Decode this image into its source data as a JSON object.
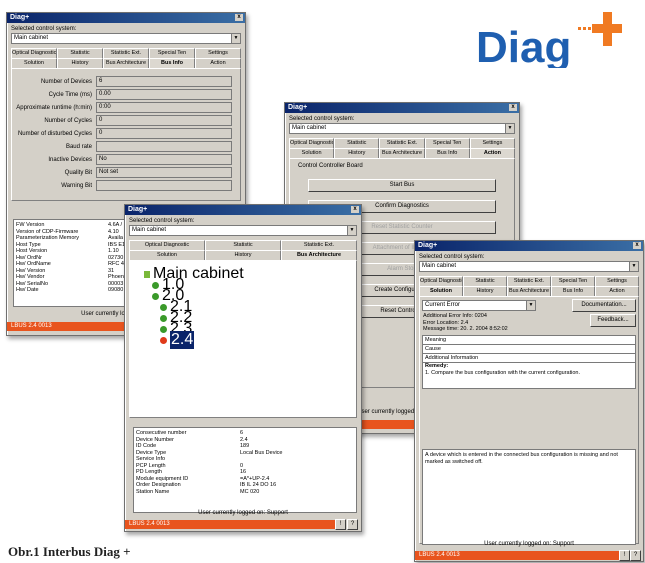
{
  "logo": {
    "text": "Diag",
    "plus": "+"
  },
  "caption": "Obr.1 Interbus Diag +",
  "common": {
    "app_title": "Diag+",
    "close": "x",
    "selected_label": "Selected control system:",
    "selected_value": "Main cabinet",
    "status_text": "User currently logged on: Support",
    "status_bar": "LBUS 2.4 0013"
  },
  "win1": {
    "tabs_row1": [
      "Optical Diagnostic",
      "Statistic",
      "Statistic Ext.",
      "Special Ten",
      "Settings"
    ],
    "tabs_row2": [
      "Solution",
      "History",
      "Bus Architecture",
      "Bus Info",
      "Action"
    ],
    "fields": [
      {
        "label": "Number of Devices",
        "value": "6"
      },
      {
        "label": "Cycle Time (ms)",
        "value": "0.00"
      },
      {
        "label": "Approximate runtime (h:min)",
        "value": "0:00"
      },
      {
        "label": "Number of Cycles",
        "value": "0"
      },
      {
        "label": "Number of disturbed Cycles",
        "value": "0"
      },
      {
        "label": "Baud rate",
        "value": ""
      },
      {
        "label": "Inactive Devices",
        "value": "No"
      },
      {
        "label": "Quality Bit",
        "value": "Not set"
      },
      {
        "label": "Warning Bit",
        "value": ""
      }
    ],
    "info": [
      {
        "k": "FW Version",
        "v": "4.6A /"
      },
      {
        "k": "Version of CDP-Firmware",
        "v": "4.10"
      },
      {
        "k": "Parameterization Memory",
        "v": "Availa"
      },
      {
        "k": "Host Type",
        "v": "IBS E1"
      },
      {
        "k": "Host Version",
        "v": "1.10"
      },
      {
        "k": "Hw/ OrdNr",
        "v": "02730"
      },
      {
        "k": "Hw/ OrdName",
        "v": "RFC 4"
      },
      {
        "k": "Hw/ Version",
        "v": "31"
      },
      {
        "k": "Hw/ Vendor",
        "v": "Phoen"
      },
      {
        "k": "Hw/ SerialNo",
        "v": "00003"
      },
      {
        "k": "Hw/ Date",
        "v": "09080"
      }
    ]
  },
  "win2": {
    "tabs_row1": [
      "Optical Diagnostic",
      "Statistic",
      "Statistic Ext.",
      "Special Ten",
      "Settings"
    ],
    "tabs_row2": [
      "Solution",
      "History",
      "Bus Architecture",
      "Bus Info",
      "Action"
    ],
    "group_title": "Control Controller Board",
    "buttons": [
      "Start Bus",
      "Confirm Diagnostics",
      "Reset Statistic Counter",
      "Attachment of IP-Host",
      "Alarm Stop",
      "Create Configuration",
      "Reset Controller"
    ]
  },
  "win3": {
    "tabs_row1": [
      "Optical Diagnostic",
      "Statistic",
      "Statistic Ext."
    ],
    "tabs_row2": [
      "Solution",
      "History",
      "Bus Architecture"
    ],
    "tree": [
      {
        "label": "Main cabinet"
      },
      {
        "label": "1.0"
      },
      {
        "label": "2.0"
      },
      {
        "label": "2.1"
      },
      {
        "label": "2.2"
      },
      {
        "label": "2.3"
      },
      {
        "label": "2.4"
      }
    ],
    "props": [
      {
        "k": "Consecutive number",
        "v": "6"
      },
      {
        "k": "Device Number",
        "v": "2.4"
      },
      {
        "k": "ID Code",
        "v": "189"
      },
      {
        "k": "Device Type",
        "v": "Local Bus Device"
      },
      {
        "k": "Service Info",
        "v": ""
      },
      {
        "k": "PCP Length",
        "v": "0"
      },
      {
        "k": "PD Length",
        "v": "16"
      },
      {
        "k": "Module equipment ID",
        "v": "=A*+UP-2.4"
      },
      {
        "k": "Order Designation",
        "v": "IB IL 24 DO 16"
      },
      {
        "k": "Station Name",
        "v": "MC 020"
      }
    ],
    "nav": [
      "!",
      "?"
    ]
  },
  "win4": {
    "tabs_row1": [
      "Optical Diagnostic",
      "Statistic",
      "Statistic Ext.",
      "Special Ten",
      "Settings"
    ],
    "tabs_row2": [
      "Solution",
      "History",
      "Bus Architecture",
      "Bus Info",
      "Action"
    ],
    "error_select": "Current Error",
    "documentation": "Documentation...",
    "feedback": "Feedback...",
    "error_info": [
      "Additional Error Info: 0204",
      "Error Location: 2.4",
      "Message time: 20. 2. 2004 8:52:02"
    ],
    "list": [
      "Meaning",
      "Cause",
      "Additional Information"
    ],
    "remedy_title": "Remedy:",
    "remedy_text": "1. Compare the bus configuration with the current configuration.",
    "description": "A device which is entered in the connected bus configuration is missing and not marked as switched off.",
    "nav": [
      "!",
      "?"
    ]
  },
  "colors": {
    "accent_blue": "#1f5fb0",
    "logo_orange": "#f07a22",
    "status_red": "#e8541e",
    "node_green": "#3a9a2a",
    "node_red": "#e03a1a"
  }
}
